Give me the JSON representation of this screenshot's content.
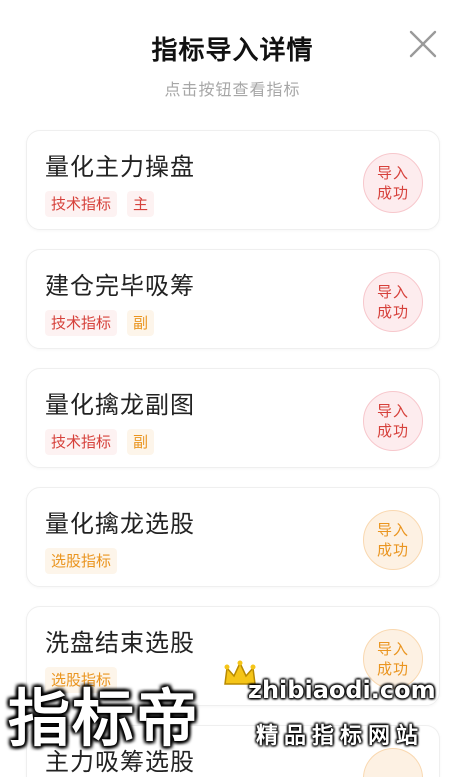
{
  "header": {
    "title": "指标导入详情",
    "subtitle": "点击按钮查看指标",
    "close_icon": "close-icon"
  },
  "colors": {
    "red": "#d6413b",
    "orange": "#ea9520",
    "title": "#111111",
    "subtitle": "#a7a7a7"
  },
  "items": [
    {
      "name": "量化主力操盘",
      "category": "技术指标",
      "role": "主",
      "status_line1": "导入",
      "status_line2": "成功",
      "status_color": "red"
    },
    {
      "name": "建仓完毕吸筹",
      "category": "技术指标",
      "role": "副",
      "status_line1": "导入",
      "status_line2": "成功",
      "status_color": "red"
    },
    {
      "name": "量化擒龙副图",
      "category": "技术指标",
      "role": "副",
      "status_line1": "导入",
      "status_line2": "成功",
      "status_color": "red"
    },
    {
      "name": "量化擒龙选股",
      "category": "选股指标",
      "role": "",
      "status_line1": "导入",
      "status_line2": "成功",
      "status_color": "orange"
    },
    {
      "name": "洗盘结束选股",
      "category": "选股指标",
      "role": "",
      "status_line1": "导入",
      "status_line2": "成功",
      "status_color": "orange"
    },
    {
      "name": "主力吸筹选股",
      "category": "",
      "role": "",
      "status_line1": "",
      "status_line2": "",
      "status_color": "orange"
    }
  ],
  "watermark": {
    "brand": "指标帝",
    "url": "zhibiaodi.com",
    "slogan": "精品指标网站",
    "crown_icon": "crown-icon"
  }
}
